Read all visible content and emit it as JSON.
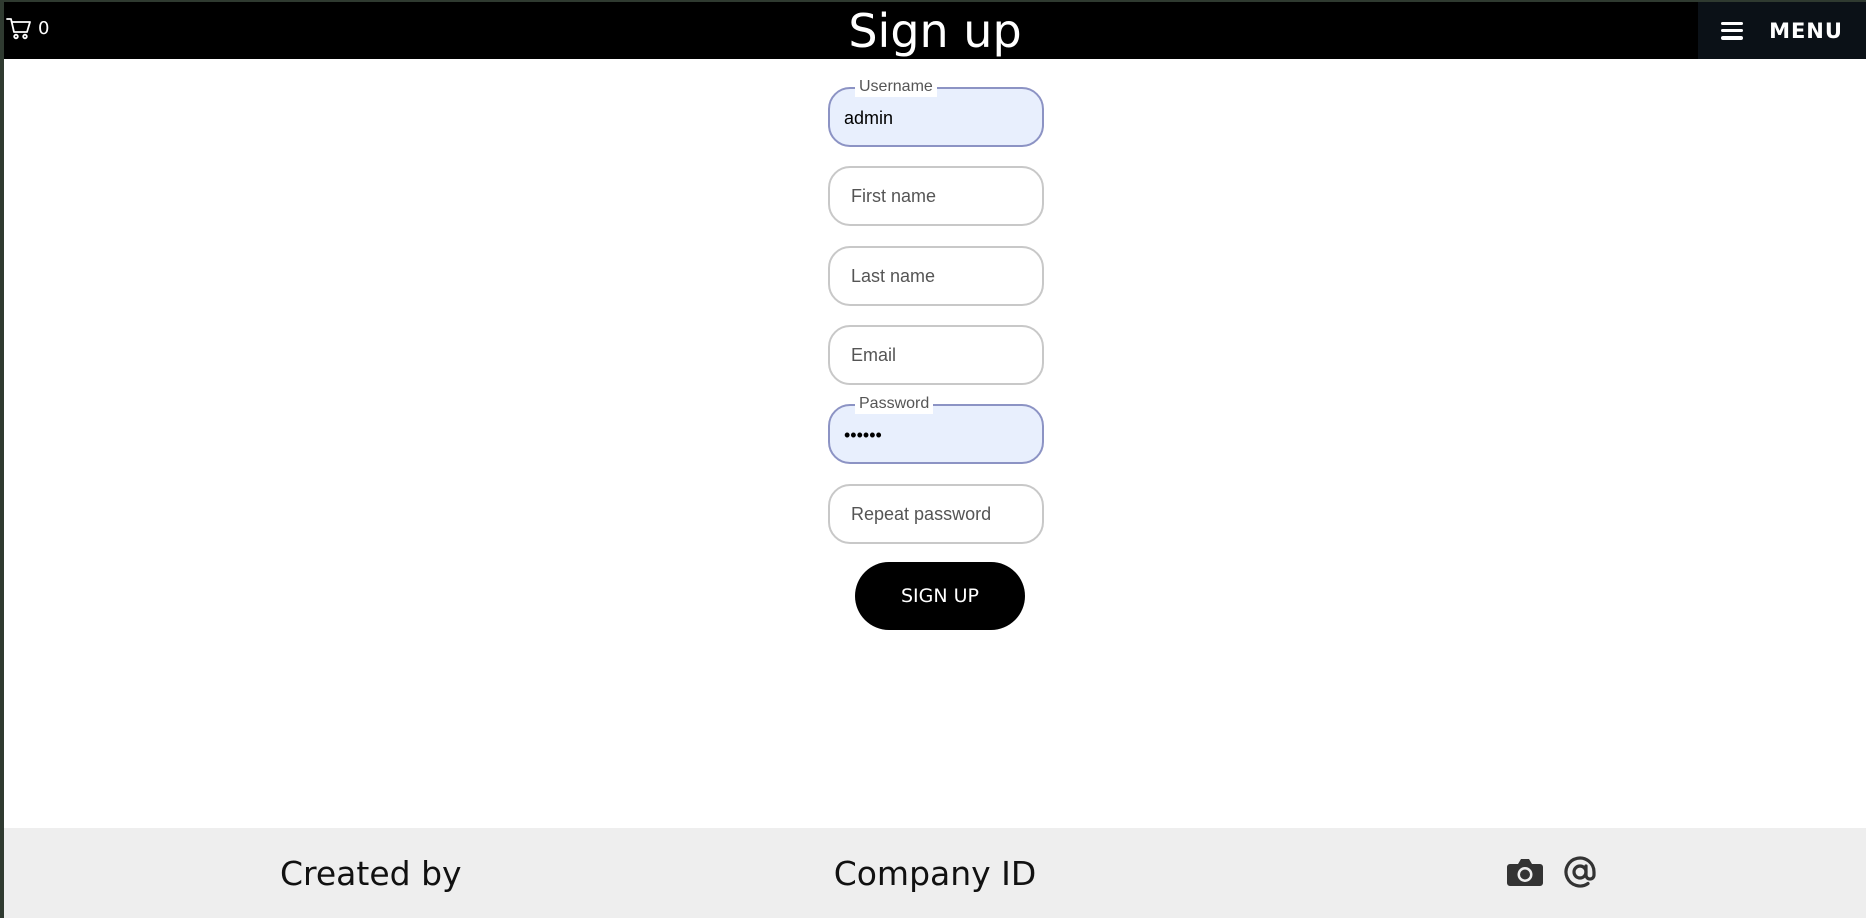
{
  "header": {
    "cart_count": "0",
    "title": "Sign up",
    "menu_label": "MENU"
  },
  "form": {
    "username": {
      "label": "Username",
      "value": "admin"
    },
    "first_name": {
      "placeholder": "First name"
    },
    "last_name": {
      "placeholder": "Last name"
    },
    "email": {
      "placeholder": "Email"
    },
    "password": {
      "label": "Password",
      "value": "••••••"
    },
    "repeat_password": {
      "placeholder": "Repeat password"
    },
    "submit_label": "SIGN UP"
  },
  "footer": {
    "created_by": "Created by",
    "company_id": "Company ID",
    "icons": [
      "camera-icon",
      "at-sign-icon"
    ]
  },
  "colors": {
    "header_bg": "#000000",
    "filled_field_bg": "#e8effd",
    "filled_field_border": "#8c93c4",
    "footer_bg": "#eeeeee"
  }
}
